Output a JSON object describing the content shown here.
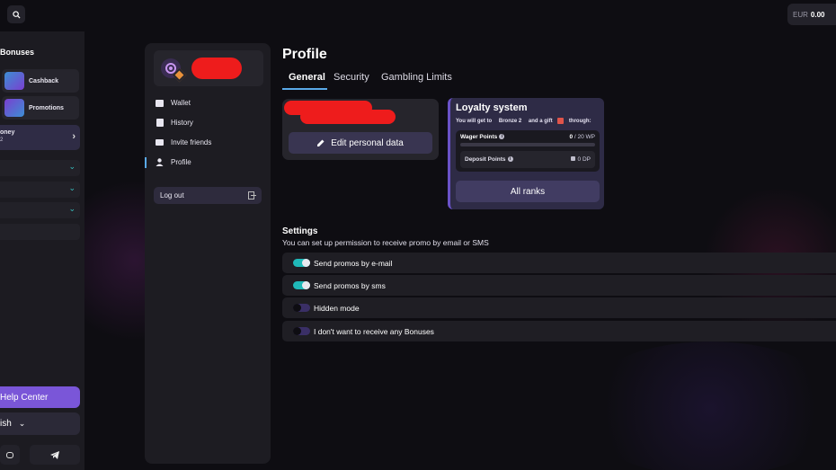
{
  "header": {
    "search_icon": "search-icon",
    "balance_currency": "EUR",
    "balance_amount": "0.00"
  },
  "left_sidebar": {
    "bonuses_title": "Bonuses",
    "items": [
      {
        "label": "Cashback",
        "icon": "cashback-icon"
      },
      {
        "label": "Promotions",
        "icon": "promotions-icon"
      }
    ],
    "money_label": "oney",
    "money_sub": "2",
    "help_center": "Help Center",
    "language": "ish"
  },
  "account_menu": {
    "items": [
      {
        "label": "Wallet",
        "icon": "wallet-icon"
      },
      {
        "label": "History",
        "icon": "history-icon"
      },
      {
        "label": "Invite friends",
        "icon": "invite-icon"
      },
      {
        "label": "Profile",
        "icon": "user-icon"
      }
    ],
    "active": "Profile",
    "logout": "Log out"
  },
  "main": {
    "title": "Profile",
    "tabs": [
      {
        "label": "General",
        "active": true
      },
      {
        "label": "Security",
        "active": false
      },
      {
        "label": "Gambling Limits",
        "active": false
      }
    ],
    "edit_button": "Edit personal data"
  },
  "loyalty": {
    "title": "Loyalty system",
    "sub_prefix": "You will get to",
    "rank": "Bronze 2",
    "sub_mid": "and a gift",
    "sub_suffix": "through:",
    "wager_label": "Wager Points",
    "wager_current": "0",
    "wager_target": "/ 20 WP",
    "wager_progress": 0,
    "deposit_label": "Deposit Points",
    "deposit_value": "0 DP",
    "all_ranks": "All ranks"
  },
  "settings": {
    "title": "Settings",
    "subtitle": "You can set up permission to receive promo by email or SMS",
    "items": [
      {
        "label": "Send promos by e-mail",
        "on": true
      },
      {
        "label": "Send promos by sms",
        "on": true
      },
      {
        "label": "Hidden mode",
        "on": false
      },
      {
        "label": "I don't want to receive any Bonuses",
        "on": false
      }
    ]
  },
  "colors": {
    "accent": "#7a56d8",
    "toggle_on": "#1fb8b8",
    "toggle_off": "#3a2f66",
    "tab_underline": "#5aa9e8"
  }
}
